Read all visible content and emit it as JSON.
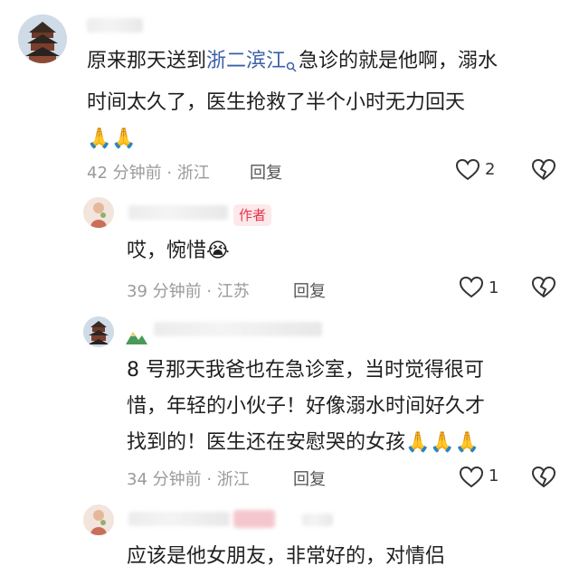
{
  "comments": [
    {
      "body_prefix": "原来那天送到",
      "link_text": "浙二滨江",
      "body_suffix": "急诊的就是他啊，溺水",
      "body_line2": "时间太久了，医生抢救了半个小时无力回天",
      "emoji_line": "🙏🙏",
      "meta": "42 分钟前 · 浙江",
      "reply_label": "回复",
      "like_count": "2",
      "icons": [
        "pavilion-avatar",
        "search-icon",
        "heart-icon",
        "broken-heart-icon"
      ]
    },
    {
      "author_tag": "作者",
      "body": "哎，惋惜😭",
      "meta": "39 分钟前 · 江苏",
      "reply_label": "回复",
      "like_count": "1",
      "icons": [
        "figure-avatar",
        "heart-icon",
        "broken-heart-icon"
      ]
    },
    {
      "body_line1": "8 号那天我爸也在急诊室，当时觉得很可",
      "body_line2": "惜，年轻的小伙子！好像溺水时间好久才",
      "body_line3": "找到的！医生还在安慰哭的女孩🙏🙏🙏",
      "meta": "34 分钟前 · 浙江",
      "reply_label": "回复",
      "like_count": "1",
      "icons": [
        "pavilion-avatar",
        "heart-icon",
        "broken-heart-icon"
      ]
    },
    {
      "body_partial": "应该是他女朋友，非常好的，对情侣",
      "icons": [
        "figure-avatar"
      ]
    }
  ],
  "colors": {
    "link": "#3b5fa8",
    "author_tag_bg": "#fde8ea",
    "author_tag_text": "#e8334a",
    "meta": "#9a9a9a"
  }
}
